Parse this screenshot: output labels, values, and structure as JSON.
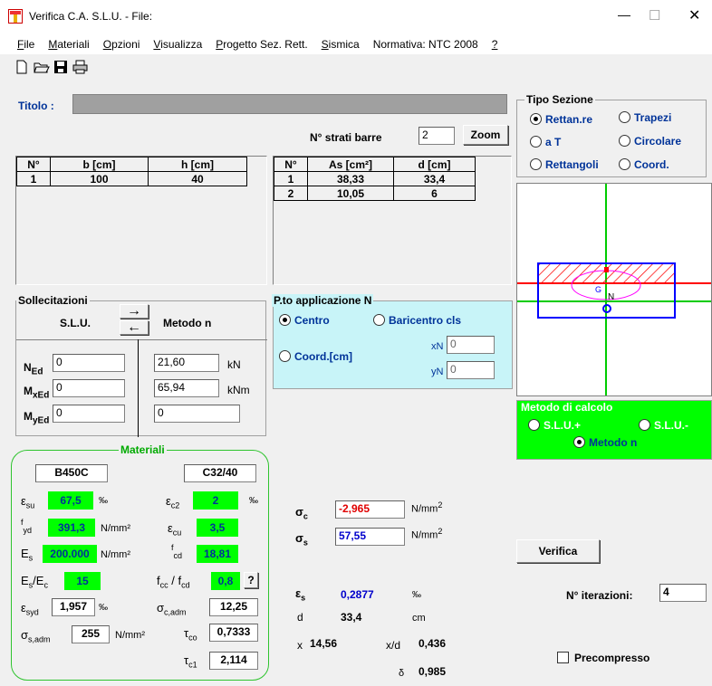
{
  "window": {
    "title": "Verifica C.A. S.L.U. - File:",
    "minimize_glyph": "—",
    "maximize_glyph": "☐",
    "close_glyph": "✕"
  },
  "menu": [
    {
      "label": "File",
      "ul": "F",
      "rest": "ile"
    },
    {
      "label": "Materiali",
      "ul": "M",
      "rest": "ateriali"
    },
    {
      "label": "Opzioni",
      "ul": "O",
      "rest": "pzioni"
    },
    {
      "label": "Visualizza",
      "ul": "V",
      "rest": "isualizza"
    },
    {
      "label": "Progetto Sez. Rett.",
      "ul": "P",
      "rest": "rogetto Sez. Rett."
    },
    {
      "label": "Sismica",
      "ul": "S",
      "rest": "ismica"
    },
    {
      "label": "Normativa: NTC 2008",
      "ul": "",
      "rest": "Normativa: NTC 2008"
    },
    {
      "label": "?",
      "ul": "?",
      "rest": ""
    }
  ],
  "titolo_label": "Titolo :",
  "strati": {
    "label": "N° strati barre",
    "value": "2",
    "zoom": "Zoom"
  },
  "section_table": {
    "headers": [
      "N°",
      "b [cm]",
      "h [cm]"
    ],
    "rows": [
      [
        "1",
        "100",
        "40"
      ]
    ]
  },
  "bars_table": {
    "headers": [
      "N°",
      "As [cm²]",
      "d [cm]"
    ],
    "rows": [
      [
        "1",
        "38,33",
        "33,4"
      ],
      [
        "2",
        "10,05",
        "6"
      ]
    ]
  },
  "tipo_sezione": {
    "title": "Tipo Sezione",
    "options": [
      "Rettan.re",
      "Trapezi",
      "a T",
      "Circolare",
      "Rettangoli",
      "Coord."
    ],
    "selected": "Rettan.re"
  },
  "preview": {
    "colors": {
      "axis": "#00cc00",
      "red_line": "#ff0000",
      "section": "#0000ff",
      "compressed": "#ff0000",
      "ellipse": "#ff00ff"
    }
  },
  "sollecitazioni": {
    "title": "Sollecitazioni",
    "slu": "S.L.U.",
    "metodo": "Metodo n",
    "arrow_right": "→",
    "arrow_left": "←",
    "n_label": "N",
    "n_sub": "Ed",
    "mx_label": "M",
    "mx_sub": "xEd",
    "my_label": "M",
    "my_sub": "yEd",
    "slu_values": [
      "0",
      "0",
      "0"
    ],
    "metodo_values": [
      "21,60",
      "65,94",
      "0"
    ],
    "units": [
      "kN",
      "kNm"
    ]
  },
  "applicazione": {
    "title": "P.to applicazione N",
    "centro": "Centro",
    "baricentro": "Baricentro cls",
    "coord": "Coord.[cm]",
    "xn_label": "xN",
    "xn_value": "0",
    "yn_label": "yN",
    "yn_value": "0"
  },
  "metodo_calcolo": {
    "title": "Metodo di calcolo",
    "options": [
      "S.L.U.+",
      "S.L.U.-",
      "Metodo n"
    ],
    "selected": "Metodo n"
  },
  "materiali": {
    "title": "Materiali",
    "steel": "B450C",
    "concrete": "C32/40",
    "esu": "67,5",
    "esu_unit": "‰",
    "ec2": "2",
    "ec2_unit": "‰",
    "fyd": "391,3",
    "fyd_unit": "N/mm²",
    "ecu": "3,5",
    "es": "200.000",
    "es_unit": "N/mm²",
    "fcd": "18,81",
    "es_ec": "15",
    "fcc_fcd": "0,8",
    "help": "?",
    "esyd": "1,957",
    "esyd_unit": "‰",
    "sc_adm": "12,25",
    "ss_adm": "255",
    "ss_adm_unit": "N/mm²",
    "tco": "0,7333",
    "tc1": "2,114"
  },
  "results": {
    "sigma_c": "-2,965",
    "sigma_s": "57,55",
    "unit": "N/mm",
    "eps_s": "0,2877",
    "eps_unit": "‰",
    "d_label": "d",
    "d": "33,4",
    "d_unit": "cm",
    "x_label": "x",
    "x": "14,56",
    "xd_label": "x/d",
    "xd": "0,436",
    "delta_label": "δ",
    "delta": "0,985"
  },
  "verifica_label": "Verifica",
  "iterazioni": {
    "label": "N° iterazioni:",
    "value": "4"
  },
  "precompresso_label": "Precompresso"
}
